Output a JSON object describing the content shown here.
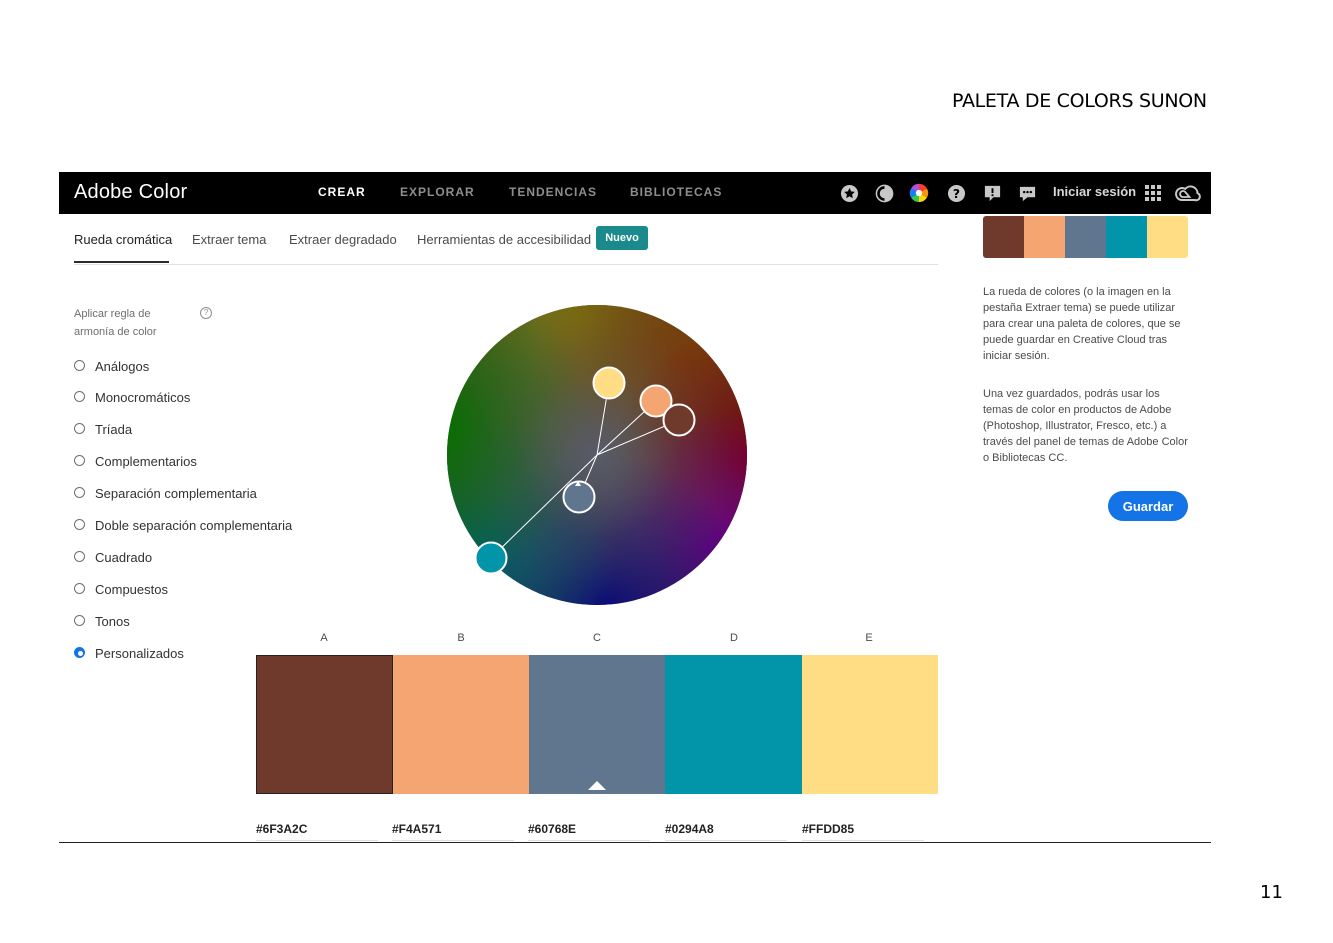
{
  "document": {
    "heading": "PALETA DE COLORS SUNON",
    "page_number": "11"
  },
  "topbar": {
    "brand": "Adobe Color",
    "nav": [
      "CREAR",
      "EXPLORAR",
      "TENDENCIAS",
      "BIBLIOTECAS"
    ],
    "active_nav": "CREAR",
    "icons": [
      "star-icon",
      "contrast-icon",
      "color-wheel-icon",
      "help-icon",
      "feedback-icon",
      "chat-icon",
      "apps-grid-icon",
      "creative-cloud-icon"
    ],
    "signin": "Iniciar sesión"
  },
  "subtabs": {
    "items": [
      "Rueda cromática",
      "Extraer tema",
      "Extraer degradado",
      "Herramientas de accesibilidad"
    ],
    "active": "Rueda cromática",
    "badge": "Nuevo"
  },
  "harmony": {
    "label": "Aplicar regla de armonía de color",
    "options": [
      "Análogos",
      "Monocromáticos",
      "Tríada",
      "Complementarios",
      "Separación complementaria",
      "Doble separación complementaria",
      "Cuadrado",
      "Compuestos",
      "Tonos",
      "Personalizados"
    ],
    "selected": "Personalizados"
  },
  "palette": {
    "letters": [
      "A",
      "B",
      "C",
      "D",
      "E"
    ],
    "colors": [
      "#6F3A2C",
      "#F4A571",
      "#60768E",
      "#0294A8",
      "#FFDD85"
    ],
    "hex_labels": [
      "#6F3A2C",
      "#F4A571",
      "#60768E",
      "#0294A8",
      "#FFDD85"
    ],
    "base_swatch": "C"
  },
  "info": {
    "paragraph1": "La rueda de colores (o la imagen en la pestaña Extraer tema) se puede utilizar para crear una paleta de colores, que se puede guardar en Creative Cloud tras iniciar sesión.",
    "paragraph2": "Una vez guardados, podrás usar los temas de color en productos de Adobe (Photoshop, Illustrator, Fresco, etc.) a través del panel de temas de Adobe Color o Bibliotecas CC.",
    "save_button": "Guardar"
  }
}
